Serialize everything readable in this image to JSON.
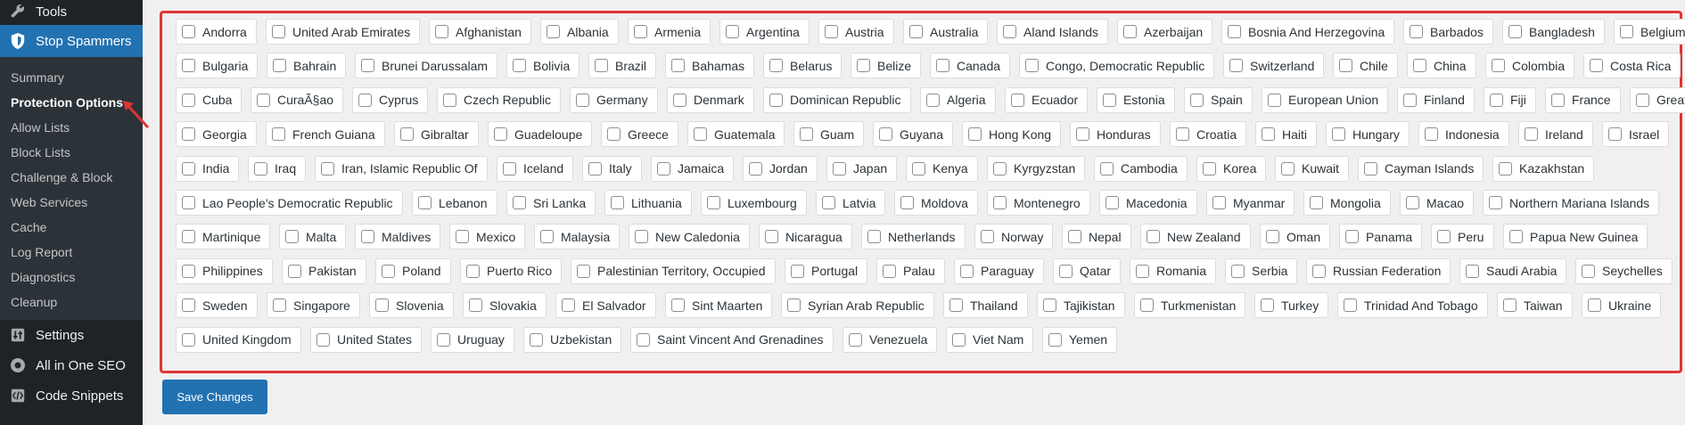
{
  "sidebar": {
    "tools": "Tools",
    "plugin": "Stop Spammers",
    "submenu": [
      "Summary",
      "Protection Options",
      "Allow Lists",
      "Block Lists",
      "Challenge & Block",
      "Web Services",
      "Cache",
      "Log Report",
      "Diagnostics",
      "Cleanup"
    ],
    "settings": "Settings",
    "seo": "All in One SEO",
    "snippets": "Code Snippets"
  },
  "colors": {
    "accent": "#2271b1",
    "sidebar_bg": "#1d2327",
    "highlight_border": "#e03434"
  },
  "countries": [
    [
      "Andorra",
      "United Arab Emirates",
      "Afghanistan",
      "Albania",
      "Armenia",
      "Argentina",
      "Austria",
      "Australia",
      "Aland Islands",
      "Azerbaijan",
      "Bosnia And Herzegovina",
      "Barbados",
      "Bangladesh",
      "Belgium"
    ],
    [
      "Bulgaria",
      "Bahrain",
      "Brunei Darussalam",
      "Bolivia",
      "Brazil",
      "Bahamas",
      "Belarus",
      "Belize",
      "Canada",
      "Congo, Democratic Republic",
      "Switzerland",
      "Chile",
      "China",
      "Colombia",
      "Costa Rica"
    ],
    [
      "Cuba",
      "CuraÃ§ao",
      "Cyprus",
      "Czech Republic",
      "Germany",
      "Denmark",
      "Dominican Republic",
      "Algeria",
      "Ecuador",
      "Estonia",
      "Spain",
      "European Union",
      "Finland",
      "Fiji",
      "France",
      "Great Britain"
    ],
    [
      "Georgia",
      "French Guiana",
      "Gibraltar",
      "Guadeloupe",
      "Greece",
      "Guatemala",
      "Guam",
      "Guyana",
      "Hong Kong",
      "Honduras",
      "Croatia",
      "Haiti",
      "Hungary",
      "Indonesia",
      "Ireland",
      "Israel"
    ],
    [
      "India",
      "Iraq",
      "Iran, Islamic Republic Of",
      "Iceland",
      "Italy",
      "Jamaica",
      "Jordan",
      "Japan",
      "Kenya",
      "Kyrgyzstan",
      "Cambodia",
      "Korea",
      "Kuwait",
      "Cayman Islands",
      "Kazakhstan"
    ],
    [
      "Lao People's Democratic Republic",
      "Lebanon",
      "Sri Lanka",
      "Lithuania",
      "Luxembourg",
      "Latvia",
      "Moldova",
      "Montenegro",
      "Macedonia",
      "Myanmar",
      "Mongolia",
      "Macao",
      "Northern Mariana Islands"
    ],
    [
      "Martinique",
      "Malta",
      "Maldives",
      "Mexico",
      "Malaysia",
      "New Caledonia",
      "Nicaragua",
      "Netherlands",
      "Norway",
      "Nepal",
      "New Zealand",
      "Oman",
      "Panama",
      "Peru",
      "Papua New Guinea"
    ],
    [
      "Philippines",
      "Pakistan",
      "Poland",
      "Puerto Rico",
      "Palestinian Territory, Occupied",
      "Portugal",
      "Palau",
      "Paraguay",
      "Qatar",
      "Romania",
      "Serbia",
      "Russian Federation",
      "Saudi Arabia",
      "Seychelles"
    ],
    [
      "Sweden",
      "Singapore",
      "Slovenia",
      "Slovakia",
      "El Salvador",
      "Sint Maarten",
      "Syrian Arab Republic",
      "Thailand",
      "Tajikistan",
      "Turkmenistan",
      "Turkey",
      "Trinidad And Tobago",
      "Taiwan",
      "Ukraine"
    ],
    [
      "United Kingdom",
      "United States",
      "Uruguay",
      "Uzbekistan",
      "Saint Vincent And Grenadines",
      "Venezuela",
      "Viet Nam",
      "Yemen"
    ]
  ],
  "save_label": "Save Changes"
}
